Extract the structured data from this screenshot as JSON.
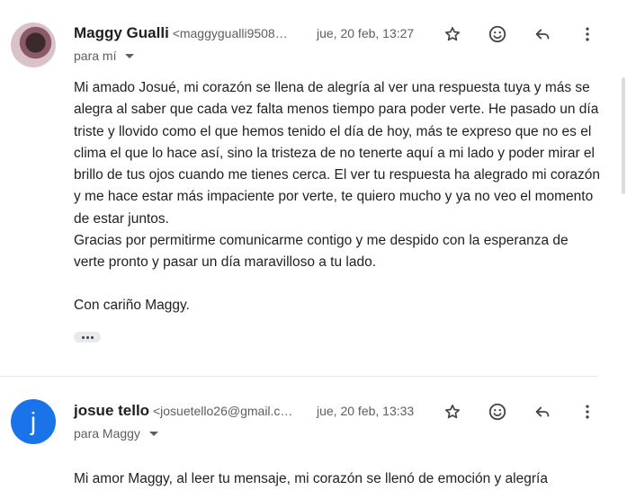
{
  "messages": [
    {
      "sender_name": "Maggy Gualli",
      "sender_email": "<maggygualli9508…",
      "date": "jue, 20 feb, 13:27",
      "recipient_line": "para mí",
      "body": [
        "Mi amado Josué, mi corazón se llena de alegría al ver una respuesta tuya y más se alegra al saber que cada vez falta menos tiempo para poder verte. He pasado un día triste y llovido como el que hemos tenido el día de hoy, más te expreso que no es el clima el que lo hace así, sino la tristeza de no tenerte aquí a mi lado y poder mirar el brillo de tus ojos cuando me tienes cerca. El ver tu respuesta ha alegrado mi corazón y me hace estar más impaciente por verte, te quiero mucho y ya no veo el momento de estar juntos.",
        "Gracias por permitirme comunicarme contigo y me despido con la esperanza de verte pronto y pasar un día maravilloso a tu lado."
      ],
      "signoff": "Con cariño Maggy.",
      "avatar": "photo"
    },
    {
      "sender_name": "josue tello",
      "sender_email": "<josuetello26@gmail.c…",
      "date": "jue, 20 feb, 13:33",
      "recipient_line": "para Maggy",
      "avatar_letter": "j",
      "avatar_color": "#1a73e8",
      "body_preview": "Mi amor Maggy, al leer tu mensaje, mi corazón se llenó de emoción y alegría"
    }
  ],
  "icons": {
    "star": "star-icon",
    "emoji": "emoji-icon",
    "reply": "reply-icon",
    "more": "more-vert-icon",
    "expand": "ellipsis-icon"
  }
}
